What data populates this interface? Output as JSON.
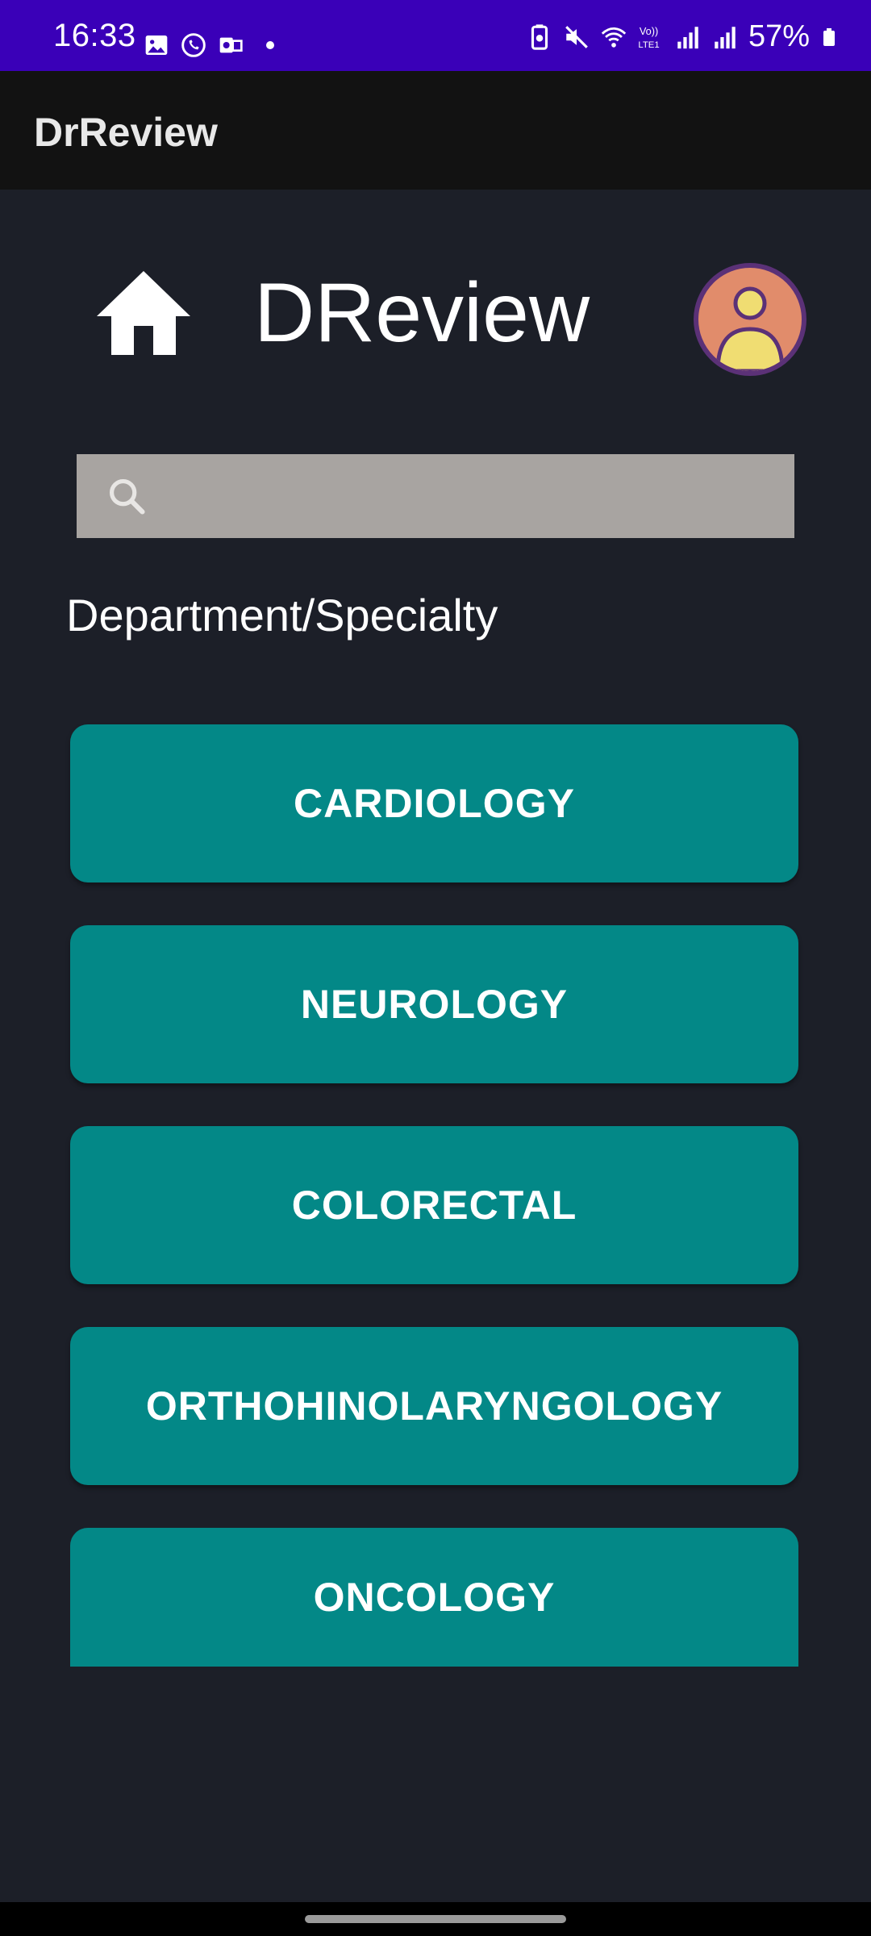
{
  "status_bar": {
    "time": "16:33",
    "battery": "57%",
    "background": "#3a00b8"
  },
  "app_bar": {
    "title": "DrReview"
  },
  "header": {
    "brand": "DReview"
  },
  "search": {
    "value": "",
    "placeholder": ""
  },
  "section": {
    "label": "Department/Specialty"
  },
  "departments": [
    {
      "label": "CARDIOLOGY"
    },
    {
      "label": "NEUROLOGY"
    },
    {
      "label": "COLORECTAL"
    },
    {
      "label": "ORTHOHINOLARYNGOLOGY"
    },
    {
      "label": "ONCOLOGY"
    }
  ],
  "colors": {
    "background": "#1c1f28",
    "button": "#038887",
    "search_bg": "#a8a4a1",
    "avatar_bg": "#e18c6b",
    "avatar_ring": "#5b3177"
  }
}
